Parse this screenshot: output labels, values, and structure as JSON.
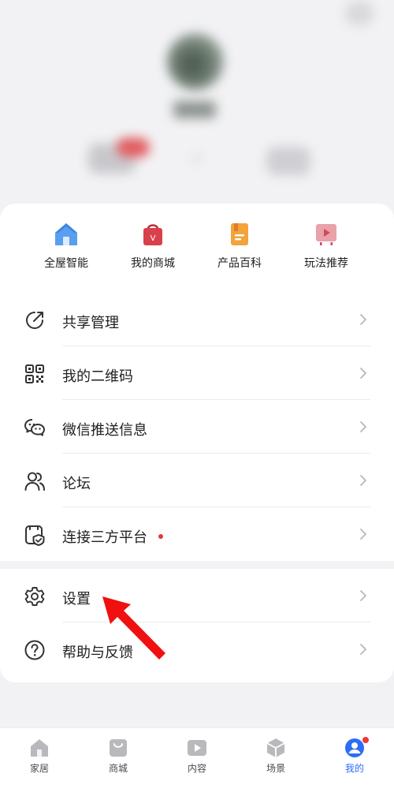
{
  "quick_actions": [
    {
      "label": "全屋智能",
      "icon": "house-icon",
      "color": "#5a9ef0"
    },
    {
      "label": "我的商城",
      "icon": "shopping-bag-icon",
      "color": "#d8404b"
    },
    {
      "label": "产品百科",
      "icon": "book-icon",
      "color": "#f2a33a"
    },
    {
      "label": "玩法推荐",
      "icon": "video-play-icon",
      "color": "#e27a86"
    }
  ],
  "menu": [
    {
      "label": "共享管理",
      "icon": "share-icon"
    },
    {
      "label": "我的二维码",
      "icon": "qr-code-icon"
    },
    {
      "label": "微信推送信息",
      "icon": "wechat-icon"
    },
    {
      "label": "论坛",
      "icon": "users-icon"
    },
    {
      "label": "连接三方平台",
      "icon": "shield-link-icon",
      "has_badge": true
    }
  ],
  "menu2": [
    {
      "label": "设置",
      "icon": "gear-icon"
    },
    {
      "label": "帮助与反馈",
      "icon": "help-icon"
    }
  ],
  "tabbar": [
    {
      "label": "家居",
      "icon": "home-tab-icon",
      "active": false
    },
    {
      "label": "商城",
      "icon": "shop-tab-icon",
      "active": false
    },
    {
      "label": "内容",
      "icon": "content-tab-icon",
      "active": false
    },
    {
      "label": "场景",
      "icon": "scene-tab-icon",
      "active": false
    },
    {
      "label": "我的",
      "icon": "profile-tab-icon",
      "active": true,
      "has_badge": true
    }
  ],
  "colors": {
    "accent": "#2d6cf6",
    "badge": "#e03a3a",
    "annotation_arrow": "#f01010"
  }
}
